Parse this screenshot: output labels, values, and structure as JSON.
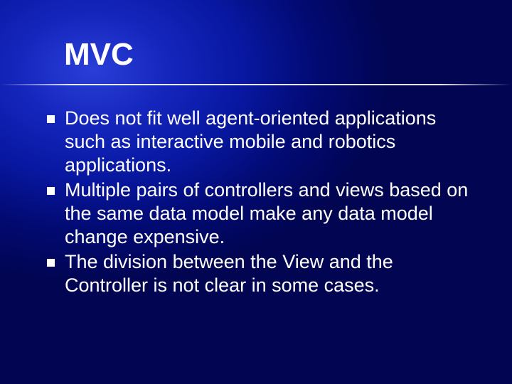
{
  "slide": {
    "title": "MVC",
    "bullets": [
      "Does not fit well agent-oriented applications such as interactive mobile and robotics applications.",
      "Multiple pairs of controllers and views based on the same data model make any data model change expensive.",
      "The division between the View and the Controller is not clear in some cases."
    ]
  }
}
